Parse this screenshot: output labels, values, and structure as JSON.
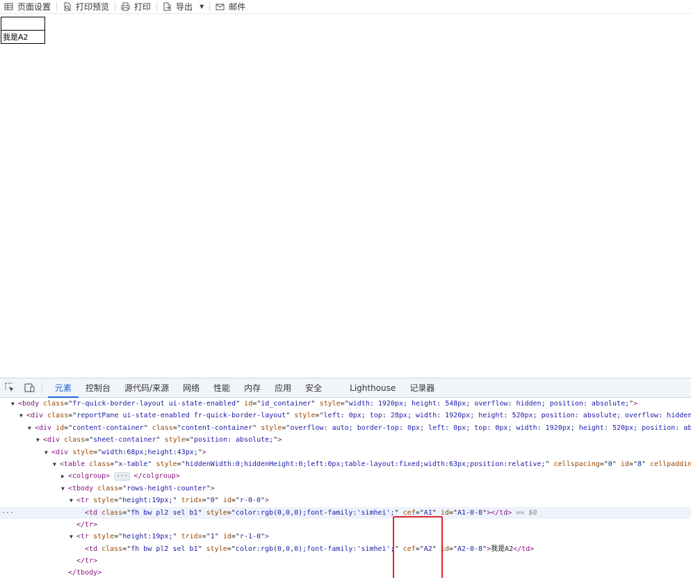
{
  "toolbar": {
    "page_setup": "页面设置",
    "print_preview": "打印预览",
    "print": "打印",
    "export": "导出",
    "mail": "邮件"
  },
  "report": {
    "rows": [
      "",
      "我是A2"
    ]
  },
  "devtools": {
    "tabs": [
      "元素",
      "控制台",
      "源代码/来源",
      "网络",
      "性能",
      "内存",
      "应用",
      "安全",
      "Lighthouse",
      "记录器"
    ],
    "active_tab": "元素",
    "dom": {
      "body_tag": "<body",
      "body_class": "fr-quick-border-layout ui-state-enabled",
      "body_id": "id_container",
      "body_style": "width: 1920px; height: 548px; overflow: hidden; position: absolute;",
      "rp_class": "reportPane ui-state-enabled fr-quick-border-layout",
      "rp_style": "left: 0px; top: 28px; width: 1920px; height: 520px; position: absolute; overflow: hidden",
      "cc_id": "content-container",
      "cc_class": "content-container",
      "cc_style": "overflow: auto; border-top: 0px; left: 0px; top: 0px; width: 1920px; height: 520px; position: ab",
      "sc_class": "sheet-container",
      "sc_style": "position: absolute;",
      "div_style": "width:68px;height:43px;",
      "table_class": "x-table",
      "table_style": "hiddenWidth:0;hiddenHeight:0;left:0px;table-layout:fixed;width:63px;position:relative;",
      "table_cellspacing": "0",
      "table_id": "8",
      "table_tail": "cellpaddin",
      "colgroup_open": "<colgroup>",
      "colgroup_close": "</colgroup>",
      "ellipsis": "···",
      "tbody_class": "rows-height-counter",
      "tr_style": "height:19px;",
      "tr1_tridx": "0",
      "tr1_id": "r-0-0",
      "td_class": "fh bw pl2 sel b1",
      "td_style": "color:rgb(0,0,0);font-family:'simhei';",
      "td1_cef": "A1",
      "td1_id": "A1-0-8",
      "eq_marker": "== $0",
      "tr2_tridx": "1",
      "tr2_id": "r-1-0",
      "td2_cef": "A2",
      "td2_id": "A2-0-8",
      "td2_text": "我是A2",
      "more": "···"
    }
  },
  "colors": {
    "highlight_box": "#e0262b",
    "active_tab": "#1a65d6",
    "tag": "#881280",
    "attr_name": "#994500",
    "attr_value": "#1a1aa6"
  }
}
